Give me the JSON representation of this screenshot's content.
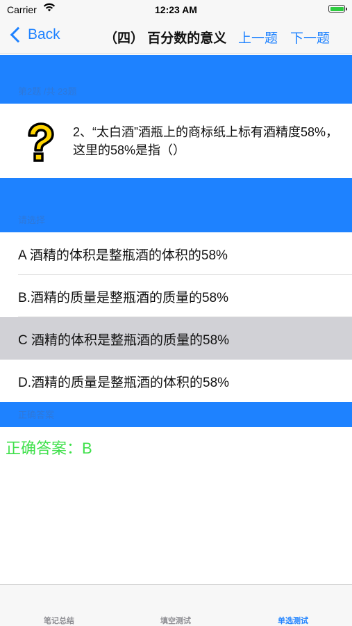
{
  "status_bar": {
    "carrier": "Carrier",
    "time": "12:23 AM"
  },
  "nav": {
    "back_label": "Back",
    "title": "（四） 百分数的意义",
    "prev_label": "上一题",
    "next_label": "下一题"
  },
  "question": {
    "header": "第2题 /共 23题",
    "text": "2、“太白酒”酒瓶上的商标纸上标有酒精度58%，这里的58%是指（）"
  },
  "options": {
    "header": "请选择",
    "items": [
      {
        "label": "A 酒精的体积是整瓶酒的体积的58%"
      },
      {
        "label": "B.酒精的质量是整瓶酒的质量的58%"
      },
      {
        "label": "C 酒精的体积是整瓶酒的质量的58%"
      },
      {
        "label": "D.酒精的质量是整瓶酒的体积的58%"
      }
    ],
    "selected_index": 2
  },
  "answer": {
    "header": "正确答案",
    "text": "正确答案：B"
  },
  "tabs": [
    {
      "label": "笔记总结"
    },
    {
      "label": "填空测试"
    },
    {
      "label": "单选测试"
    }
  ],
  "colors": {
    "accent": "#1e82ff",
    "answer": "#3ee04a",
    "selected_row": "#d1d1d6",
    "icon_yellow": "#ffd400"
  }
}
